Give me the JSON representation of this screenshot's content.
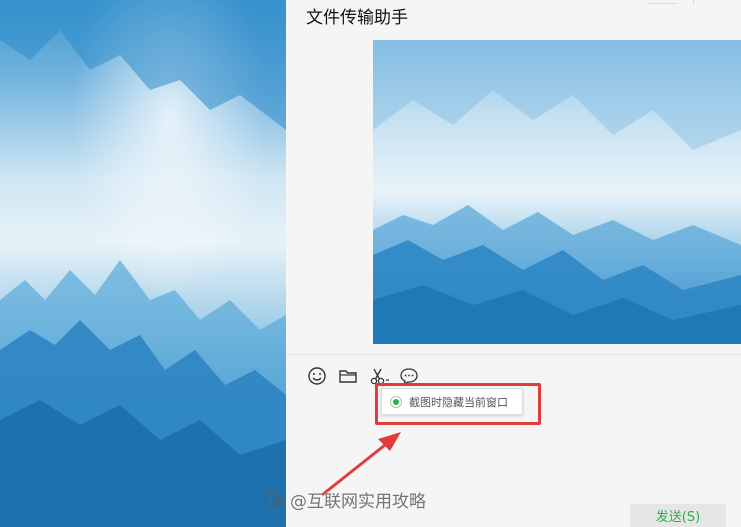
{
  "chat": {
    "title": "文件传输助手"
  },
  "toolbar": {
    "icons": [
      "emoji-icon",
      "folder-icon",
      "scissors-icon",
      "chat-history-icon"
    ]
  },
  "screenshot_popup": {
    "option_label": "截图时隐藏当前窗口",
    "checked": true
  },
  "send_button": {
    "label": "发送(S)"
  },
  "watermark": {
    "text": "@互联网实用攻略"
  },
  "colors": {
    "annotation_red": "#e23b3b",
    "radio_green": "#2aae4a",
    "send_text_green": "#2aae4a",
    "window_bg": "#f5f5f5"
  }
}
